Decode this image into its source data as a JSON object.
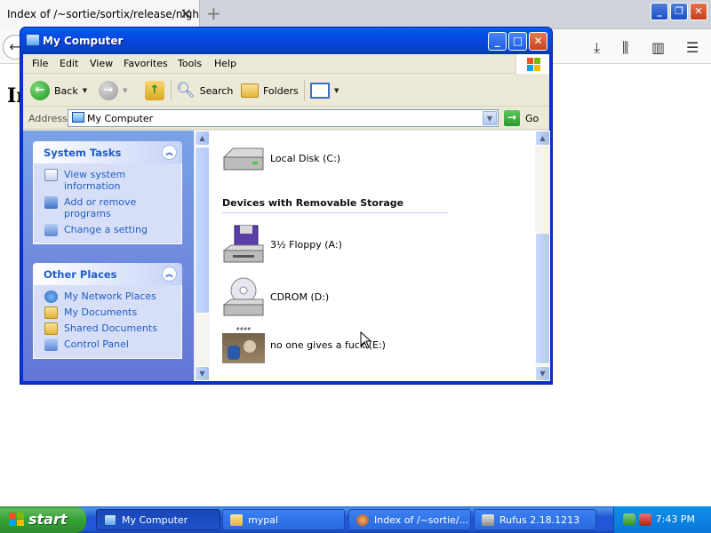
{
  "browser": {
    "tab_title": "Index of /~sortie/sortix/release/nightl",
    "tab_close": "✕",
    "new_tab": "+",
    "page_heading": "In"
  },
  "window": {
    "title": "My Computer",
    "menu": [
      "File",
      "Edit",
      "View",
      "Favorites",
      "Tools",
      "Help"
    ],
    "toolbar": {
      "back": "Back",
      "search": "Search",
      "folders": "Folders"
    },
    "address": {
      "label": "Address",
      "value": "My Computer",
      "go": "Go"
    }
  },
  "task_pane": {
    "system_tasks": {
      "title": "System Tasks",
      "items": [
        {
          "label": "View system information",
          "icon": "system-info-icon"
        },
        {
          "label": "Add or remove programs",
          "icon": "add-remove-icon"
        },
        {
          "label": "Change a setting",
          "icon": "control-panel-icon"
        }
      ]
    },
    "other_places": {
      "title": "Other Places",
      "items": [
        {
          "label": "My Network Places",
          "icon": "network-icon"
        },
        {
          "label": "My Documents",
          "icon": "folder-icon"
        },
        {
          "label": "Shared Documents",
          "icon": "folder-icon"
        },
        {
          "label": "Control Panel",
          "icon": "control-panel-icon"
        }
      ]
    }
  },
  "content": {
    "local_disk": "Local Disk (C:)",
    "removable_header": "Devices with Removable Storage",
    "floppy": "3½ Floppy (A:)",
    "cdrom": "CDROM (D:)",
    "image_drive": "no one gives a fuck (E:)",
    "image_caption": "#### "
  },
  "taskbar": {
    "start": "start",
    "items": [
      "My Computer",
      "mypal",
      "Index of /~sortie/...",
      "Rufus 2.18.1213"
    ],
    "clock": "7:43 PM"
  }
}
